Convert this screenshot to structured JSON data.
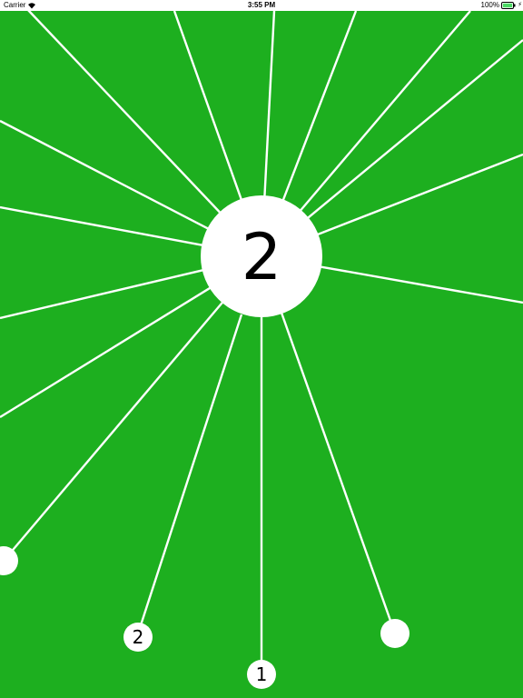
{
  "status_bar": {
    "carrier": "Carrier",
    "time": "3:55 PM",
    "battery": "100%"
  },
  "game": {
    "current_level": "2",
    "background_color": "#1daf1f",
    "ball_color": "#ffffff",
    "pending_balls": [
      "2",
      "1"
    ]
  }
}
